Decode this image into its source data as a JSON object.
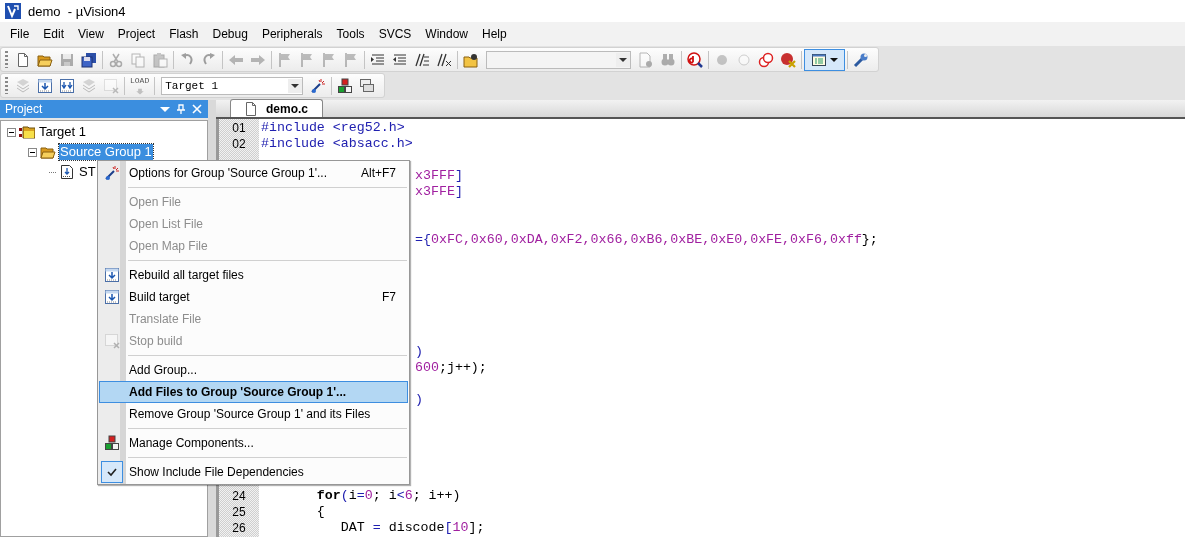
{
  "window": {
    "title": "demo  - µVision4"
  },
  "menu_bar": [
    "File",
    "Edit",
    "View",
    "Project",
    "Flash",
    "Debug",
    "Peripherals",
    "Tools",
    "SVCS",
    "Window",
    "Help"
  ],
  "toolbar_1": {
    "items": [
      {
        "kind": "button",
        "disabled": false,
        "on": false
      },
      {
        "kind": "button",
        "disabled": false,
        "on": false
      },
      {
        "kind": "button",
        "disabled": true,
        "on": false
      },
      {
        "kind": "button",
        "disabled": false,
        "on": false
      },
      {
        "kind": "separator"
      },
      {
        "kind": "button",
        "disabled": true,
        "on": false
      },
      {
        "kind": "button",
        "disabled": true,
        "on": false
      },
      {
        "kind": "button",
        "disabled": true,
        "on": false
      },
      {
        "kind": "separator"
      },
      {
        "kind": "button",
        "disabled": true,
        "on": false
      },
      {
        "kind": "button",
        "disabled": true,
        "on": false
      },
      {
        "kind": "separator"
      },
      {
        "kind": "button",
        "disabled": true,
        "on": false
      },
      {
        "kind": "button",
        "disabled": true,
        "on": false
      },
      {
        "kind": "separator"
      },
      {
        "kind": "button",
        "disabled": true,
        "on": false
      },
      {
        "kind": "button",
        "disabled": true,
        "on": false
      },
      {
        "kind": "button",
        "disabled": true,
        "on": false
      },
      {
        "kind": "button",
        "disabled": true,
        "on": false
      },
      {
        "kind": "separator"
      },
      {
        "kind": "button",
        "disabled": false,
        "on": false
      },
      {
        "kind": "button",
        "disabled": false,
        "on": false
      },
      {
        "kind": "button",
        "disabled": false,
        "on": false
      },
      {
        "kind": "button",
        "disabled": false,
        "on": false
      },
      {
        "kind": "separator"
      },
      {
        "kind": "button",
        "disabled": false,
        "on": false
      },
      {
        "kind": "combo"
      },
      {
        "kind": "button",
        "disabled": true,
        "on": false
      },
      {
        "kind": "button",
        "disabled": true,
        "on": false
      },
      {
        "kind": "separator"
      },
      {
        "kind": "button",
        "disabled": false,
        "on": false
      },
      {
        "kind": "separator"
      },
      {
        "kind": "button",
        "disabled": true,
        "on": false
      },
      {
        "kind": "button",
        "disabled": true,
        "on": false
      },
      {
        "kind": "button",
        "disabled": false,
        "on": false
      },
      {
        "kind": "button",
        "disabled": false,
        "on": false
      },
      {
        "kind": "separator"
      },
      {
        "kind": "button",
        "disabled": false,
        "on": true
      },
      {
        "kind": "separator"
      },
      {
        "kind": "button",
        "disabled": false,
        "on": false
      }
    ]
  },
  "toolbar_2": {
    "items": [
      {
        "kind": "button",
        "disabled": true,
        "on": false
      },
      {
        "kind": "button",
        "disabled": false,
        "on": false
      },
      {
        "kind": "button",
        "disabled": false,
        "on": false
      },
      {
        "kind": "button",
        "disabled": true,
        "on": false
      },
      {
        "kind": "button",
        "disabled": true,
        "on": false
      },
      {
        "kind": "separator"
      },
      {
        "kind": "load",
        "label": "LOAD",
        "disabled": true,
        "on": false
      },
      {
        "kind": "separator"
      },
      {
        "kind": "combo",
        "value": "Target 1"
      },
      {
        "kind": "button",
        "disabled": false,
        "on": false
      },
      {
        "kind": "separator"
      },
      {
        "kind": "button",
        "disabled": false,
        "on": false
      },
      {
        "kind": "button",
        "disabled": false,
        "on": false
      }
    ]
  },
  "project_panel": {
    "title": "Project",
    "tree": [
      {
        "label": "Target 1",
        "expanded": true,
        "selected": false,
        "children": [
          {
            "label": "Source Group 1",
            "expanded": true,
            "selected": true,
            "children": [
              {
                "label": "ST",
                "selected": false
              }
            ]
          }
        ]
      }
    ]
  },
  "editor": {
    "tabs": [
      {
        "label": "demo.c",
        "selected": true
      }
    ],
    "lines": [
      {
        "kind": "line",
        "number": "01",
        "segments": [
          {
            "text": "#include <reg52.h>",
            "kind": "keyword"
          }
        ]
      },
      {
        "kind": "line",
        "number": "02",
        "segments": [
          {
            "text": "#include <absacc.h>",
            "kind": "keyword"
          }
        ]
      },
      {
        "kind": "covered"
      },
      {
        "kind": "fragment",
        "segments": [
          {
            "text": "x3FFF",
            "kind": "number"
          },
          {
            "text": "]",
            "kind": "operator"
          }
        ]
      },
      {
        "kind": "fragment",
        "segments": [
          {
            "text": "x3FFE",
            "kind": "number"
          },
          {
            "text": "]",
            "kind": "operator"
          }
        ]
      },
      {
        "kind": "covered"
      },
      {
        "kind": "covered"
      },
      {
        "kind": "fragment",
        "segments": [
          {
            "text": "={",
            "kind": "operator"
          },
          {
            "text": "0xFC,0x60,0xDA,0xF2,0x66,0xB6,0xBE,0xE0,0xFE,0xF6,0xff",
            "kind": "number"
          },
          {
            "text": "};",
            "kind": "plain"
          }
        ]
      },
      {
        "kind": "covered"
      },
      {
        "kind": "covered"
      },
      {
        "kind": "covered"
      },
      {
        "kind": "covered"
      },
      {
        "kind": "covered"
      },
      {
        "kind": "covered"
      },
      {
        "kind": "fragment",
        "segments": [
          {
            "text": ")",
            "kind": "operator"
          }
        ]
      },
      {
        "kind": "fragment",
        "segments": [
          {
            "text": "600",
            "kind": "number"
          },
          {
            "text": ";j++);",
            "kind": "plain"
          }
        ]
      },
      {
        "kind": "covered"
      },
      {
        "kind": "fragment",
        "segments": [
          {
            "text": ")",
            "kind": "operator"
          }
        ]
      },
      {
        "kind": "covered"
      },
      {
        "kind": "covered"
      },
      {
        "kind": "covered"
      },
      {
        "kind": "covered"
      },
      {
        "kind": "covered"
      },
      {
        "kind": "line",
        "number": "24",
        "segments": [
          {
            "text": "       for",
            "kind": "bold"
          },
          {
            "text": "(",
            "kind": "operator"
          },
          {
            "text": "i",
            "kind": "plain"
          },
          {
            "text": "=",
            "kind": "operator"
          },
          {
            "text": "0",
            "kind": "number"
          },
          {
            "text": "; i",
            "kind": "plain"
          },
          {
            "text": "<",
            "kind": "operator"
          },
          {
            "text": "6",
            "kind": "number"
          },
          {
            "text": "; i++)",
            "kind": "plain"
          }
        ]
      },
      {
        "kind": "line",
        "number": "25",
        "segments": [
          {
            "text": "       {",
            "kind": "plain"
          }
        ]
      },
      {
        "kind": "line",
        "number": "26",
        "segments": [
          {
            "text": "          DAT ",
            "kind": "plain"
          },
          {
            "text": "=",
            "kind": "operator"
          },
          {
            "text": " discode",
            "kind": "plain"
          },
          {
            "text": "[",
            "kind": "operator"
          },
          {
            "text": "10",
            "kind": "number"
          },
          {
            "text": "];",
            "kind": "plain"
          }
        ]
      }
    ]
  },
  "context_menu": {
    "entries": [
      {
        "kind": "item",
        "label": "Options for Group 'Source Group 1'...",
        "shortcut": "Alt+F7",
        "disabled": false,
        "selected": false,
        "checked": false
      },
      {
        "kind": "separator"
      },
      {
        "kind": "item",
        "label": "Open File",
        "disabled": true,
        "selected": false,
        "checked": false
      },
      {
        "kind": "item",
        "label": "Open List File",
        "disabled": true,
        "selected": false,
        "checked": false
      },
      {
        "kind": "item",
        "label": "Open Map File",
        "disabled": true,
        "selected": false,
        "checked": false
      },
      {
        "kind": "separator"
      },
      {
        "kind": "item",
        "label": "Rebuild all target files",
        "disabled": false,
        "selected": false,
        "checked": false
      },
      {
        "kind": "item",
        "label": "Build target",
        "shortcut": "F7",
        "disabled": false,
        "selected": false,
        "checked": false
      },
      {
        "kind": "item",
        "label": "Translate File",
        "disabled": true,
        "selected": false,
        "checked": false
      },
      {
        "kind": "item",
        "label": "Stop build",
        "disabled": true,
        "selected": false,
        "checked": false
      },
      {
        "kind": "separator"
      },
      {
        "kind": "item",
        "label": "Add Group...",
        "disabled": false,
        "selected": false,
        "checked": false
      },
      {
        "kind": "item",
        "label": "Add Files to Group 'Source Group 1'...",
        "disabled": false,
        "selected": true,
        "checked": false
      },
      {
        "kind": "item",
        "label": "Remove Group 'Source Group 1' and its Files",
        "disabled": false,
        "selected": false,
        "checked": false
      },
      {
        "kind": "separator"
      },
      {
        "kind": "item",
        "label": "Manage Components...",
        "disabled": false,
        "selected": false,
        "checked": false
      },
      {
        "kind": "separator"
      },
      {
        "kind": "item",
        "label": "Show Include File Dependencies",
        "disabled": false,
        "selected": false,
        "checked": true
      }
    ]
  }
}
